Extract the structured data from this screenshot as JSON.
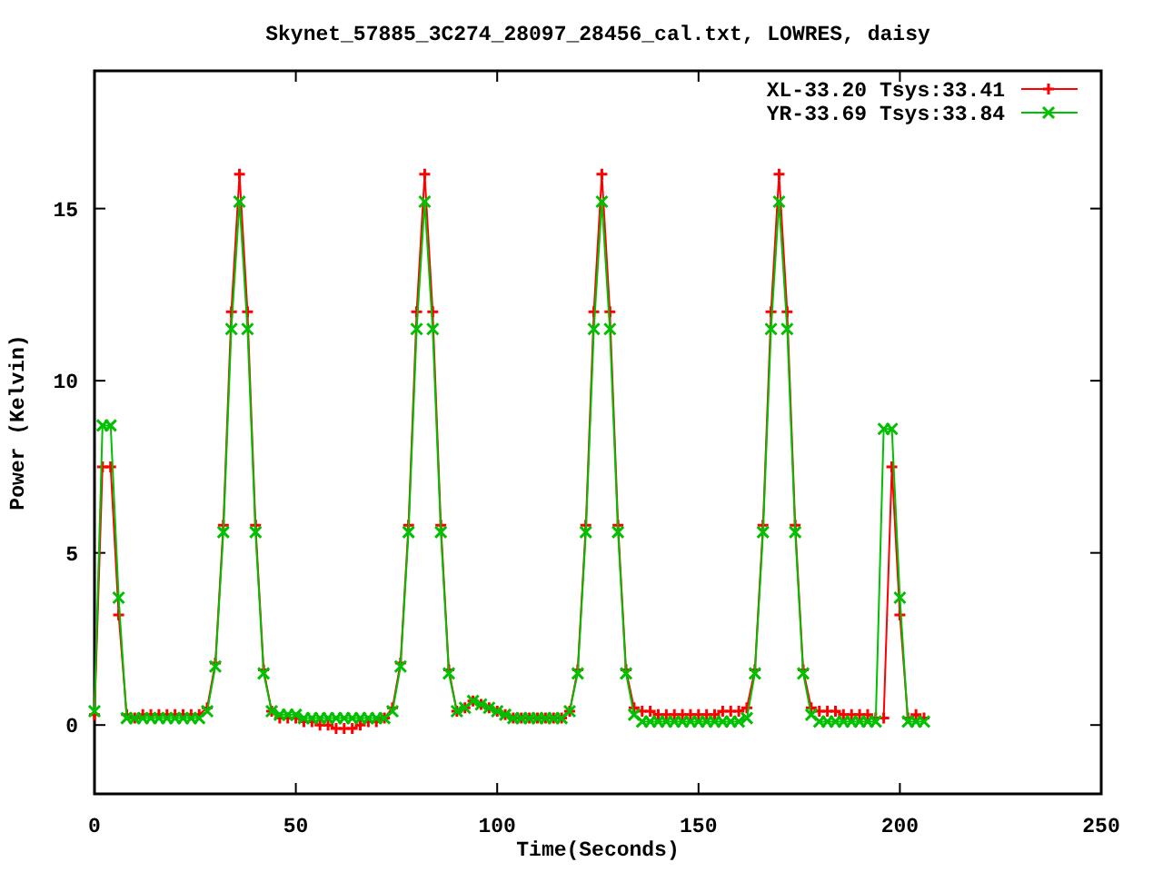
{
  "chart_data": {
    "type": "line",
    "title": "Skynet_57885_3C274_28097_28456_cal.txt, LOWRES, daisy",
    "xlabel": "Time(Seconds)",
    "ylabel": "Power (Kelvin)",
    "xlim": [
      0,
      250
    ],
    "ylim": [
      -2,
      19
    ],
    "xticks": [
      0,
      50,
      100,
      150,
      200,
      250
    ],
    "yticks": [
      0,
      5,
      10,
      15
    ],
    "legend": "top-right",
    "x": [
      0,
      2,
      4,
      6,
      8,
      10,
      12,
      14,
      16,
      18,
      20,
      22,
      24,
      26,
      28,
      30,
      32,
      34,
      36,
      38,
      40,
      42,
      44,
      46,
      48,
      50,
      52,
      54,
      56,
      58,
      60,
      62,
      64,
      66,
      68,
      70,
      72,
      74,
      76,
      78,
      80,
      82,
      84,
      86,
      88,
      90,
      92,
      94,
      96,
      98,
      100,
      102,
      104,
      106,
      108,
      110,
      112,
      114,
      116,
      118,
      120,
      122,
      124,
      126,
      128,
      130,
      132,
      134,
      136,
      138,
      140,
      142,
      144,
      146,
      148,
      150,
      152,
      154,
      156,
      158,
      160,
      162,
      164,
      166,
      168,
      170,
      172,
      174,
      176,
      178,
      180,
      182,
      184,
      186,
      188,
      190,
      192,
      194,
      196,
      198,
      200,
      202,
      204,
      206
    ],
    "series": [
      {
        "name": "XL-33.20 Tsys:33.41",
        "color": "#ff0000",
        "marker": "plus",
        "values": [
          0.3,
          7.5,
          7.5,
          3.2,
          0.3,
          0.2,
          0.3,
          0.3,
          0.3,
          0.3,
          0.3,
          0.3,
          0.3,
          0.3,
          0.5,
          1.8,
          5.8,
          12,
          16,
          12,
          5.8,
          1.6,
          0.4,
          0.2,
          0.2,
          0.2,
          0.1,
          0.1,
          0,
          0,
          -0.1,
          -0.1,
          -0.1,
          0,
          0.1,
          0.1,
          0.2,
          0.5,
          1.8,
          5.8,
          12,
          16,
          12,
          5.8,
          1.6,
          0.4,
          0.5,
          0.7,
          0.6,
          0.5,
          0.4,
          0.3,
          0.2,
          0.2,
          0.2,
          0.2,
          0.2,
          0.2,
          0.2,
          0.4,
          1.6,
          5.8,
          12,
          16,
          12,
          5.8,
          1.6,
          0.5,
          0.4,
          0.4,
          0.3,
          0.3,
          0.3,
          0.3,
          0.3,
          0.3,
          0.3,
          0.3,
          0.4,
          0.4,
          0.4,
          0.5,
          1.6,
          5.8,
          12,
          16,
          12,
          5.8,
          1.6,
          0.5,
          0.4,
          0.4,
          0.4,
          0.3,
          0.3,
          0.3,
          0.3,
          0.2,
          0.2,
          7.5,
          3.2,
          0.2,
          0.3,
          0.2
        ]
      },
      {
        "name": "YR-33.69 Tsys:33.84",
        "color": "#00c000",
        "marker": "cross",
        "values": [
          0.4,
          8.7,
          8.7,
          3.7,
          0.2,
          0.2,
          0.2,
          0.2,
          0.2,
          0.2,
          0.2,
          0.2,
          0.2,
          0.2,
          0.4,
          1.7,
          5.6,
          11.5,
          15.2,
          11.5,
          5.6,
          1.5,
          0.4,
          0.3,
          0.3,
          0.3,
          0.2,
          0.2,
          0.2,
          0.2,
          0.2,
          0.2,
          0.2,
          0.2,
          0.2,
          0.2,
          0.2,
          0.4,
          1.7,
          5.6,
          11.5,
          15.2,
          11.5,
          5.6,
          1.5,
          0.4,
          0.5,
          0.7,
          0.6,
          0.5,
          0.4,
          0.3,
          0.2,
          0.2,
          0.2,
          0.2,
          0.2,
          0.2,
          0.2,
          0.4,
          1.5,
          5.6,
          11.5,
          15.2,
          11.5,
          5.6,
          1.5,
          0.3,
          0.1,
          0.1,
          0.1,
          0.1,
          0.1,
          0.1,
          0.1,
          0.1,
          0.1,
          0.1,
          0.1,
          0.1,
          0.1,
          0.2,
          1.5,
          5.6,
          11.5,
          15.2,
          11.5,
          5.6,
          1.5,
          0.3,
          0.1,
          0.1,
          0.1,
          0.1,
          0.1,
          0.1,
          0.1,
          0.1,
          8.6,
          8.6,
          3.7,
          0.1,
          0.1,
          0.1
        ]
      }
    ]
  }
}
